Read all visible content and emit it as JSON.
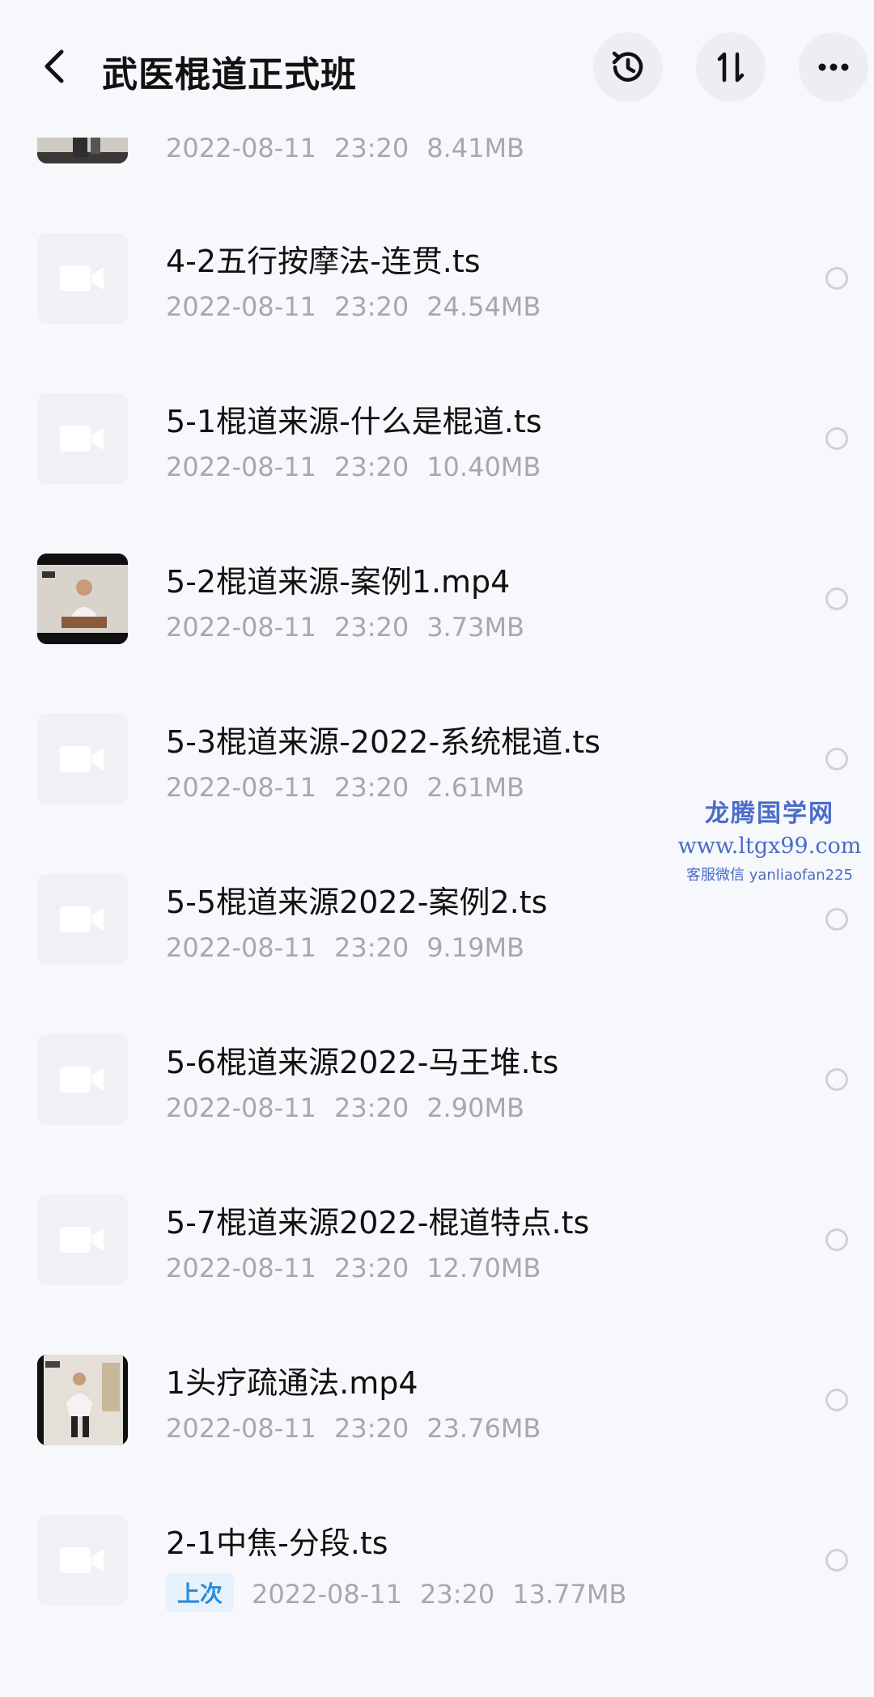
{
  "header": {
    "title": "武医棍道正式班"
  },
  "partial_item": {
    "date": "2022-08-11",
    "time": "23:20",
    "size": "8.41MB"
  },
  "items": [
    {
      "name": "4-2五行按摩法-连贯.ts",
      "date": "2022-08-11",
      "time": "23:20",
      "size": "24.54MB"
    },
    {
      "name": "5-1棍道来源-什么是棍道.ts",
      "date": "2022-08-11",
      "time": "23:20",
      "size": "10.40MB"
    },
    {
      "name": "5-2棍道来源-案例1.mp4",
      "date": "2022-08-11",
      "time": "23:20",
      "size": "3.73MB"
    },
    {
      "name": "5-3棍道来源-2022-系统棍道.ts",
      "date": "2022-08-11",
      "time": "23:20",
      "size": "2.61MB"
    },
    {
      "name": "5-5棍道来源2022-案例2.ts",
      "date": "2022-08-11",
      "time": "23:20",
      "size": "9.19MB"
    },
    {
      "name": "5-6棍道来源2022-马王堆.ts",
      "date": "2022-08-11",
      "time": "23:20",
      "size": "2.90MB"
    },
    {
      "name": "5-7棍道来源2022-棍道特点.ts",
      "date": "2022-08-11",
      "time": "23:20",
      "size": "12.70MB"
    },
    {
      "name": "1头疗疏通法.mp4",
      "date": "2022-08-11",
      "time": "23:20",
      "size": "23.76MB"
    },
    {
      "name": "2-1中焦-分段.ts",
      "badge": "上次",
      "date": "2022-08-11",
      "time": "23:20",
      "size": "13.77MB"
    }
  ],
  "watermark": {
    "title": "龙腾国学网",
    "url": "www.ltgx99.com",
    "contact": "客服微信 yanliaofan225"
  },
  "icons": {
    "back": "chevron-left-icon",
    "history": "history-icon",
    "sort": "sort-icon",
    "more": "more-dots-icon",
    "video": "video-camera-icon"
  },
  "colors": {
    "background": "#f7f8fb",
    "meta_text": "#a6a8ae",
    "badge_text": "#2d8bd8",
    "badge_bg": "#e7f1fb",
    "watermark": "#4a6cc9"
  }
}
